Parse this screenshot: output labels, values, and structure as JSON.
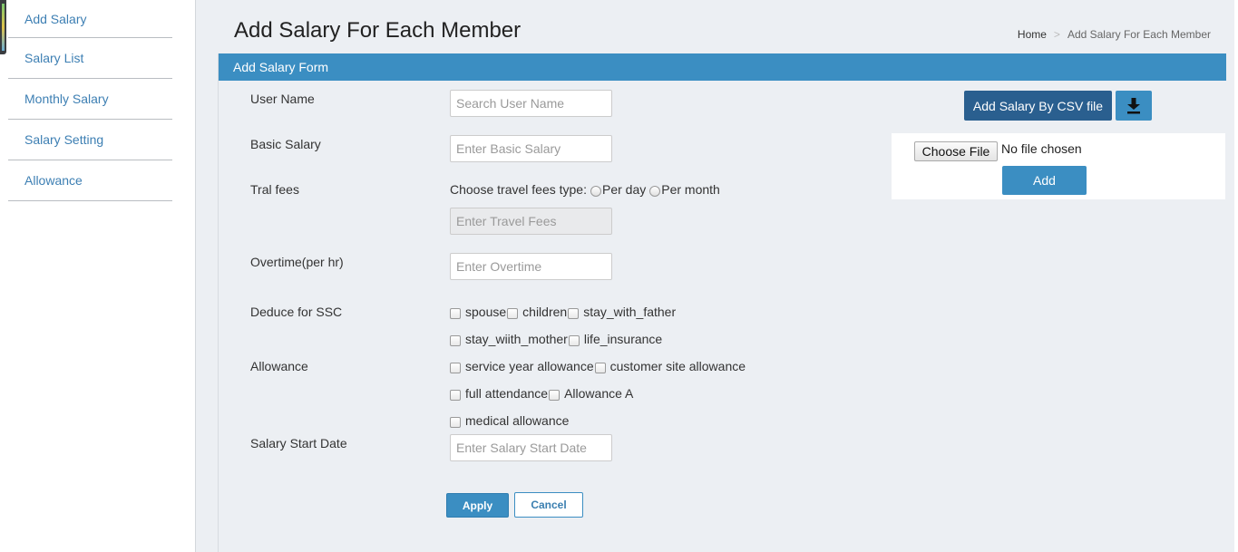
{
  "sidebar": {
    "items": [
      {
        "label": "Add Salary"
      },
      {
        "label": "Salary List"
      },
      {
        "label": "Monthly Salary"
      },
      {
        "label": "Salary Setting"
      },
      {
        "label": "Allowance"
      }
    ]
  },
  "header": {
    "title": "Add Salary For Each Member",
    "breadcrumb": {
      "home": "Home",
      "separator": ">",
      "current": "Add Salary For Each Member"
    }
  },
  "form": {
    "heading": "Add Salary Form",
    "fields": {
      "user_name": {
        "label": "User Name",
        "placeholder": "Search User Name"
      },
      "basic_salary": {
        "label": "Basic Salary",
        "placeholder": "Enter Basic Salary"
      },
      "travel_fees": {
        "label": "Tral fees",
        "type_prompt": "Choose travel fees type:",
        "options": [
          "Per day",
          "Per month"
        ],
        "placeholder": "Enter Travel Fees"
      },
      "overtime": {
        "label": "Overtime(per hr)",
        "placeholder": "Enter Overtime"
      },
      "ssc": {
        "label": "Deduce for SSC",
        "options": [
          "spouse",
          "children",
          "stay_with_father",
          "stay_wiith_mother",
          "life_insurance"
        ]
      },
      "allowance": {
        "label": "Allowance",
        "options": [
          "service year allowance",
          "customer site allowance",
          "full attendance",
          "Allowance A",
          "medical allowance"
        ]
      },
      "start_date": {
        "label": "Salary Start Date",
        "placeholder": "Enter Salary Start Date"
      }
    },
    "apply_label": "Apply",
    "cancel_label": "Cancel"
  },
  "csv": {
    "button_label": "Add Salary By CSV file",
    "download_icon": "download-icon",
    "choose_label": "Choose File",
    "no_file_text": "No file chosen",
    "add_label": "Add"
  },
  "colors": {
    "accent": "#3b8ec2",
    "dark_button": "#2a5f8f",
    "link": "#3d7fb3"
  }
}
